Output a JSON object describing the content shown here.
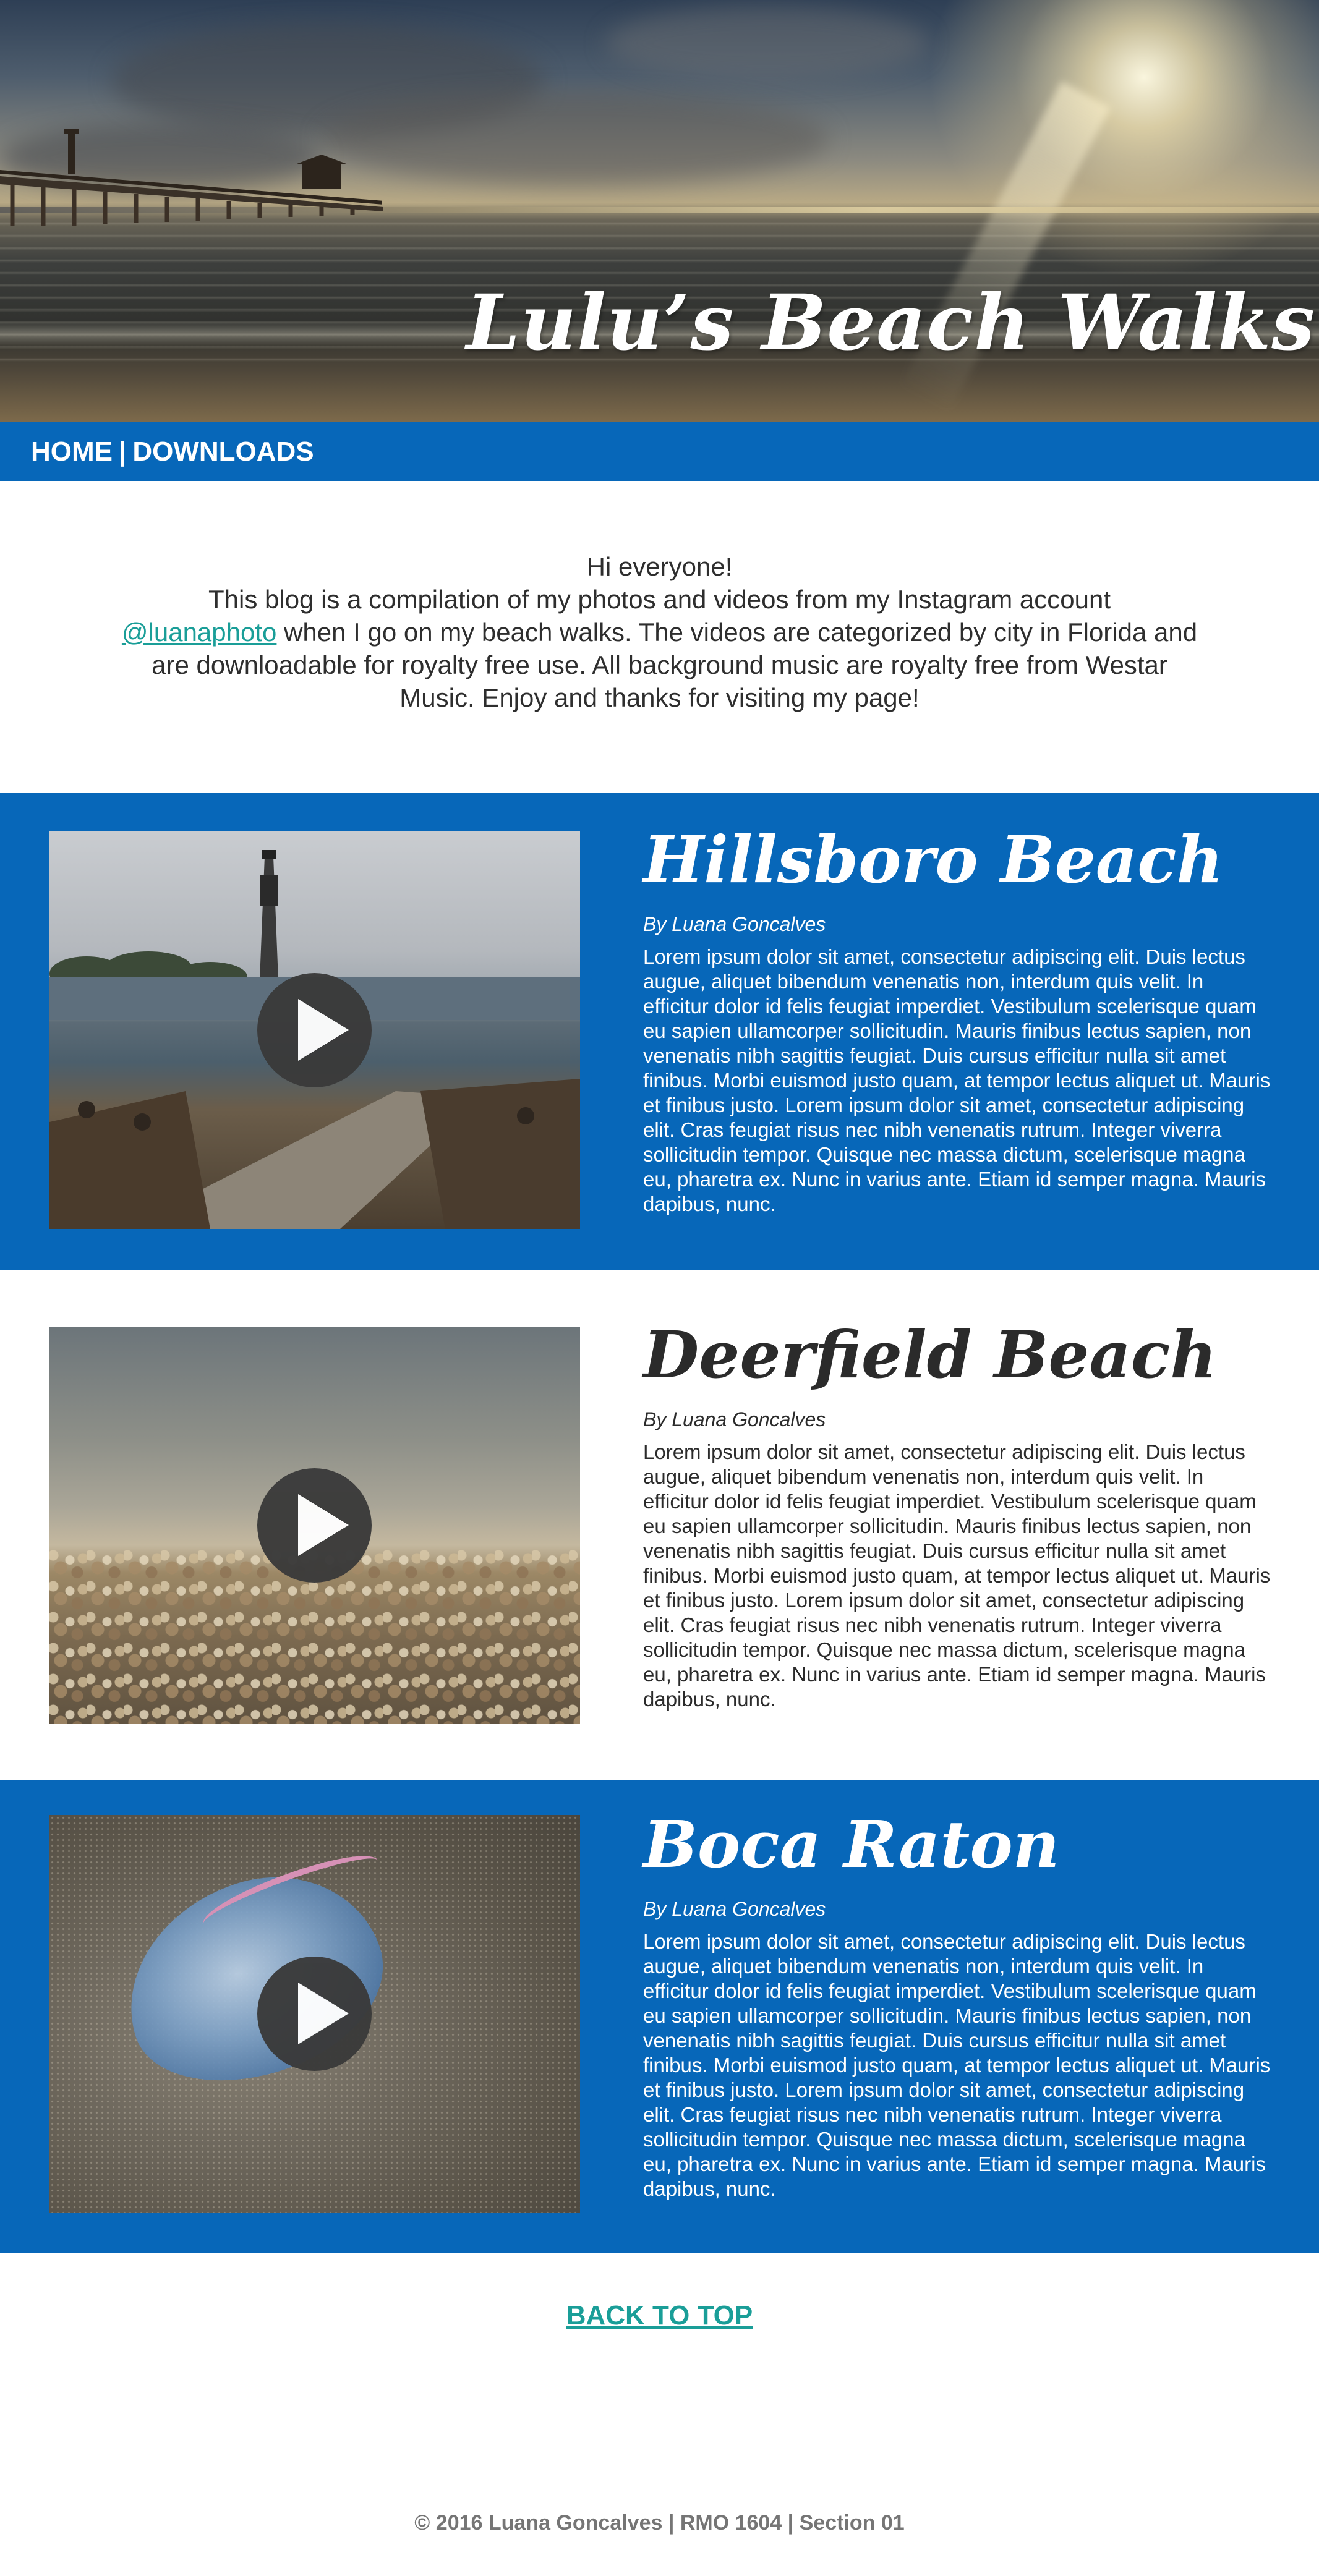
{
  "hero": {
    "title": "Lulu’s Beach Walks"
  },
  "nav": {
    "items": [
      {
        "label": "HOME"
      },
      {
        "label": "DOWNLOADS"
      }
    ],
    "separator": "|"
  },
  "intro": {
    "greeting": "Hi everyone!",
    "line1": "This blog is a compilation of my photos and videos from my Instagram account",
    "handle": "@luanaphoto",
    "line2": " when I go on my beach walks. The videos are categorized by city in Florida and are downloadable for royalty free use. All background music are royalty free from Westar Music. Enjoy and thanks for visiting my page!"
  },
  "sections": [
    {
      "title": "Hillsboro Beach",
      "byline": "By Luana Goncalves",
      "body": "Lorem ipsum dolor sit amet, consectetur adipiscing elit. Duis lectus augue, aliquet bibendum venenatis non, interdum quis velit. In efficitur dolor id felis feugiat imperdiet. Vestibulum scelerisque quam eu sapien ullamcorper sollicitudin. Mauris finibus lectus sapien, non venenatis nibh sagittis feugiat. Duis cursus efficitur nulla sit amet finibus. Morbi euismod justo quam, at tempor lectus aliquet ut. Mauris et finibus justo. Lorem ipsum dolor sit amet, consectetur adipiscing elit. Cras feugiat risus nec nibh venenatis rutrum. Integer viverra sollicitudin tempor. Quisque nec massa dictum, scelerisque magna eu, pharetra ex. Nunc in varius ante. Etiam id semper magna. Mauris dapibus, nunc."
    },
    {
      "title": "Deerfield Beach",
      "byline": "By Luana Goncalves",
      "body": "Lorem ipsum dolor sit amet, consectetur adipiscing elit. Duis lectus augue, aliquet bibendum venenatis non, interdum quis velit. In efficitur dolor id felis feugiat imperdiet. Vestibulum scelerisque quam eu sapien ullamcorper sollicitudin. Mauris finibus lectus sapien, non venenatis nibh sagittis feugiat. Duis cursus efficitur nulla sit amet finibus. Morbi euismod justo quam, at tempor lectus aliquet ut. Mauris et finibus justo. Lorem ipsum dolor sit amet, consectetur adipiscing elit. Cras feugiat risus nec nibh venenatis rutrum. Integer viverra sollicitudin tempor. Quisque nec massa dictum, scelerisque magna eu, pharetra ex. Nunc in varius ante. Etiam id semper magna. Mauris dapibus, nunc."
    },
    {
      "title": "Boca Raton",
      "byline": "By Luana Goncalves",
      "body": "Lorem ipsum dolor sit amet, consectetur adipiscing elit. Duis lectus augue, aliquet bibendum venenatis non, interdum quis velit. In efficitur dolor id felis feugiat imperdiet. Vestibulum scelerisque quam eu sapien ullamcorper sollicitudin. Mauris finibus lectus sapien, non venenatis nibh sagittis feugiat. Duis cursus efficitur nulla sit amet finibus. Morbi euismod justo quam, at tempor lectus aliquet ut. Mauris et finibus justo. Lorem ipsum dolor sit amet, consectetur adipiscing elit. Cras feugiat risus nec nibh venenatis rutrum. Integer viverra sollicitudin tempor. Quisque nec massa dictum, scelerisque magna eu, pharetra ex. Nunc in varius ante. Etiam id semper magna. Mauris dapibus, nunc."
    }
  ],
  "back_to_top": "BACK TO TOP",
  "footer": "© 2016 Luana Goncalves | RMO 1604 | Section 01",
  "colors": {
    "brand_blue": "#0767b9",
    "link_teal": "#1a9e98",
    "footer_gray": "#757575"
  },
  "icons": [
    "play-icon"
  ]
}
